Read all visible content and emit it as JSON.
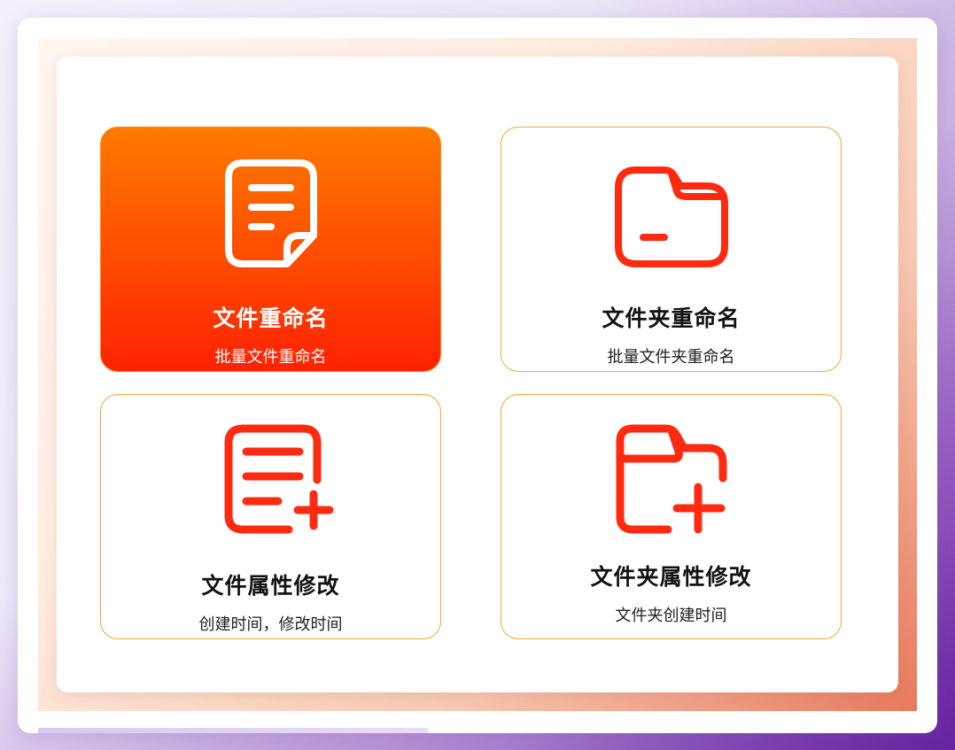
{
  "colors": {
    "accent_red": "#ff2a10",
    "accent_orange": "#ff7a00",
    "card_border": "#f0a830",
    "title_text": "#111111"
  },
  "cards": [
    {
      "title": "文件重命名",
      "desc": "批量文件重命名",
      "icon": "document-icon",
      "selected": true
    },
    {
      "title": "文件夹重命名",
      "desc": "批量文件夹重命名",
      "icon": "folder-icon",
      "selected": false
    },
    {
      "title": "文件属性修改",
      "desc": "创建时间，修改时间",
      "icon": "document-add-icon",
      "selected": false
    },
    {
      "title": "文件夹属性修改",
      "desc": "文件夹创建时间",
      "icon": "folder-add-icon",
      "selected": false
    }
  ]
}
